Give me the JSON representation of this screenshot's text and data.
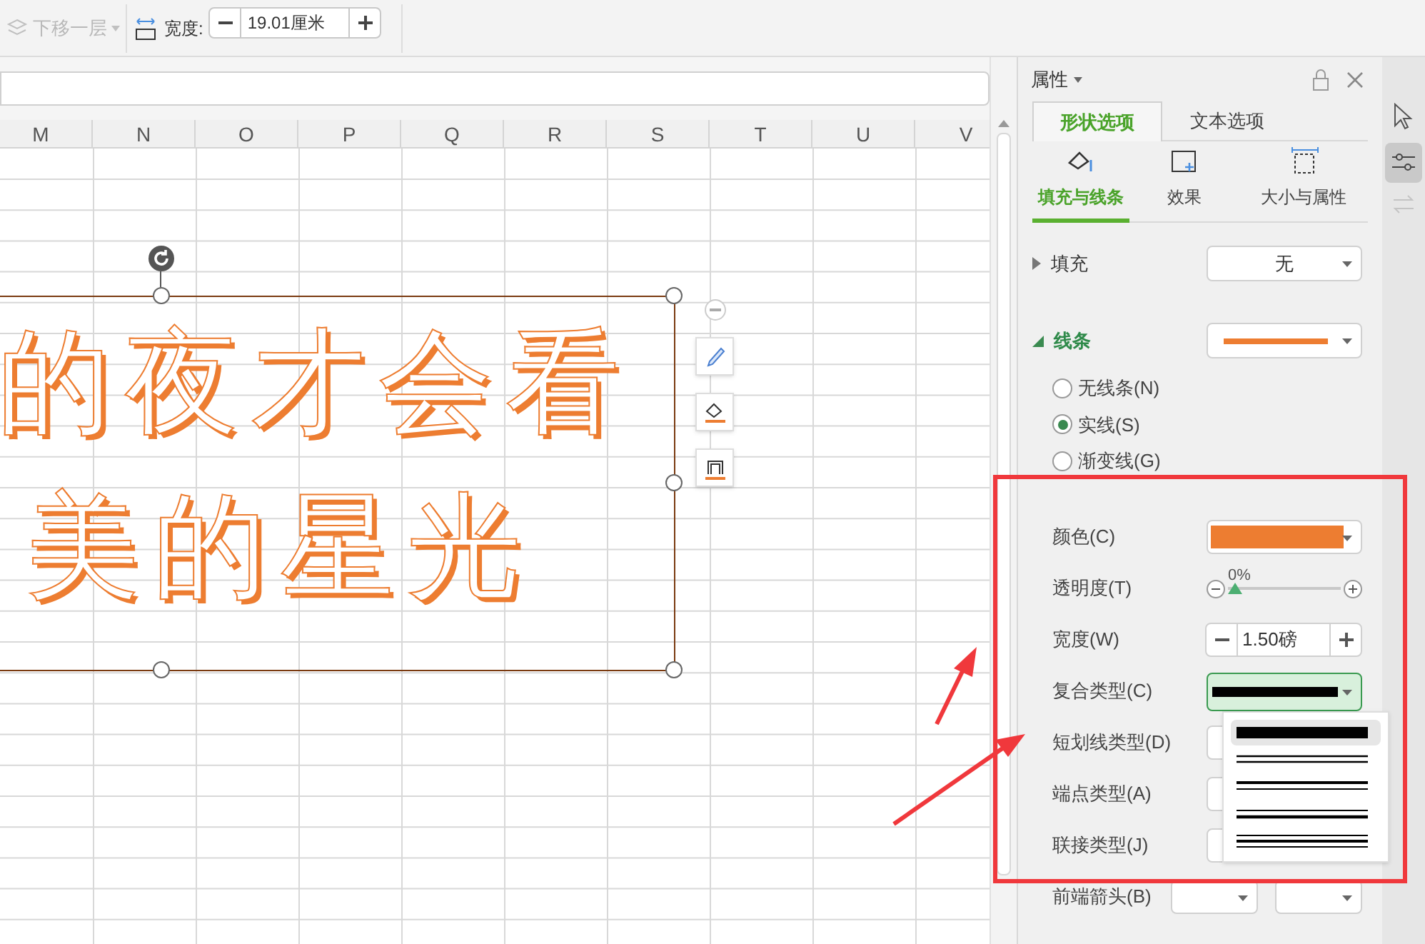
{
  "toolbar": {
    "send_backward": {
      "label": "下移一层",
      "disabled": true
    },
    "width_label": "宽度:",
    "width_value": "19.01厘米"
  },
  "columns": [
    "M",
    "N",
    "O",
    "P",
    "Q",
    "R",
    "S",
    "T",
    "U",
    "V"
  ],
  "shape": {
    "lines": [
      "的夜才会看",
      "美的星光"
    ]
  },
  "panel": {
    "title": "属性",
    "tabs": [
      {
        "label": "形状选项",
        "selected": true
      },
      {
        "label": "文本选项",
        "selected": false
      }
    ],
    "subtabs": [
      {
        "kind": "fill",
        "label": "填充与线条",
        "selected": true
      },
      {
        "kind": "effect",
        "label": "效果",
        "selected": false
      },
      {
        "kind": "size",
        "label": "大小与属性",
        "selected": false
      }
    ],
    "fill": {
      "label": "填充",
      "value": "无",
      "expanded": false
    },
    "line": {
      "label": "线条",
      "expanded": true,
      "color": "#ed7d31"
    },
    "line_options": [
      {
        "label": "无线条(N)",
        "selected": false
      },
      {
        "label": "实线(S)",
        "selected": true
      },
      {
        "label": "渐变线(G)",
        "selected": false
      }
    ],
    "props": [
      {
        "kind": "color",
        "label": "颜色(C)",
        "color": "#ed7d31"
      },
      {
        "kind": "slider",
        "label": "透明度(T)",
        "reading": "0%",
        "level": 0
      },
      {
        "kind": "spin",
        "label": "宽度(W)",
        "value": "1.50磅"
      },
      {
        "kind": "compound",
        "label": "复合类型(C)",
        "open": true
      },
      {
        "kind": "plain",
        "label": "短划线类型(D)"
      },
      {
        "kind": "plain",
        "label": "端点类型(A)"
      },
      {
        "kind": "plain",
        "label": "联接类型(J)"
      },
      {
        "kind": "pair",
        "label": "前端箭头(B)"
      }
    ],
    "compound_options": [
      {
        "kind": "single",
        "selected": true
      },
      {
        "kind": "double",
        "selected": false
      },
      {
        "kind": "thick_thin",
        "selected": false
      },
      {
        "kind": "thin_thick",
        "selected": false
      },
      {
        "kind": "triple",
        "selected": false
      }
    ]
  }
}
